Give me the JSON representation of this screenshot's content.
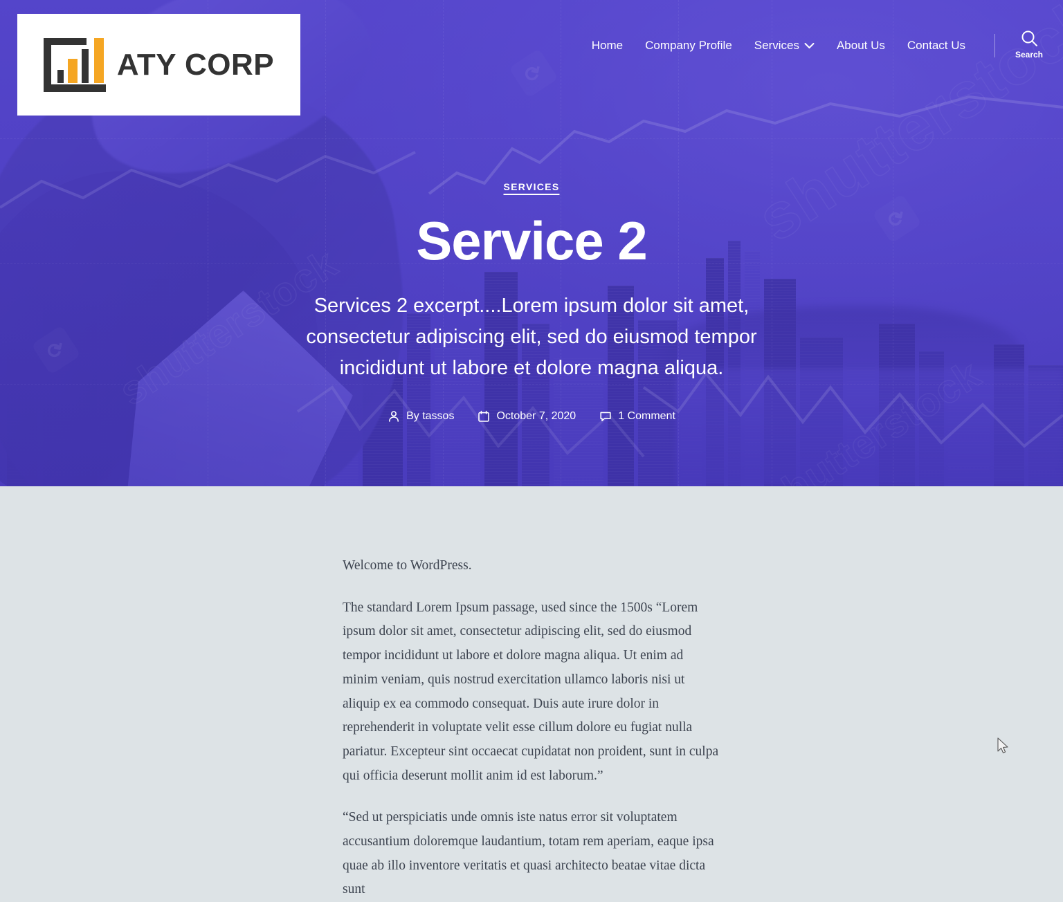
{
  "site": {
    "logo_text": "ATY CORP",
    "logo_mark_name": "bar-chart-logo-icon"
  },
  "nav": {
    "items": [
      {
        "label": "Home",
        "has_dropdown": false
      },
      {
        "label": "Company Profile",
        "has_dropdown": false
      },
      {
        "label": "Services",
        "has_dropdown": true
      },
      {
        "label": "About Us",
        "has_dropdown": false
      },
      {
        "label": "Contact Us",
        "has_dropdown": false
      }
    ],
    "chevron": "⌄",
    "search": {
      "label": "Search",
      "icon": "search-icon"
    }
  },
  "hero": {
    "category": "SERVICES",
    "title": "Service 2",
    "excerpt": "Services 2 excerpt....Lorem ipsum dolor sit amet, consectetur adipiscing elit, sed do eiusmod tempor incididunt ut labore et dolore magna aliqua.",
    "meta": {
      "author": "By tassos",
      "date": "October 7, 2020",
      "comments": "1 Comment"
    },
    "background_watermark": "shutterstock",
    "accent_color": "#5244c4"
  },
  "content": {
    "paragraphs": [
      "Welcome to WordPress.",
      "The standard Lorem Ipsum passage, used since the 1500s “Lorem ipsum dolor sit amet, consectetur adipiscing elit, sed do eiusmod tempor incididunt ut labore et dolore magna aliqua. Ut enim ad minim veniam, quis nostrud exercitation ullamco laboris nisi ut aliquip ex ea commodo consequat. Duis aute irure dolor in reprehenderit in voluptate velit esse cillum dolore eu fugiat nulla pariatur. Excepteur sint occaecat cupidatat non proident, sunt in culpa qui officia deserunt mollit anim id est laborum.”",
      "“Sed ut perspiciatis unde omnis iste natus error sit voluptatem accusantium doloremque laudantium, totam rem aperiam, eaque ipsa quae ab illo inventore veritatis et quasi architecto beatae vitae dicta sunt"
    ],
    "background_color": "#dde3e6"
  }
}
